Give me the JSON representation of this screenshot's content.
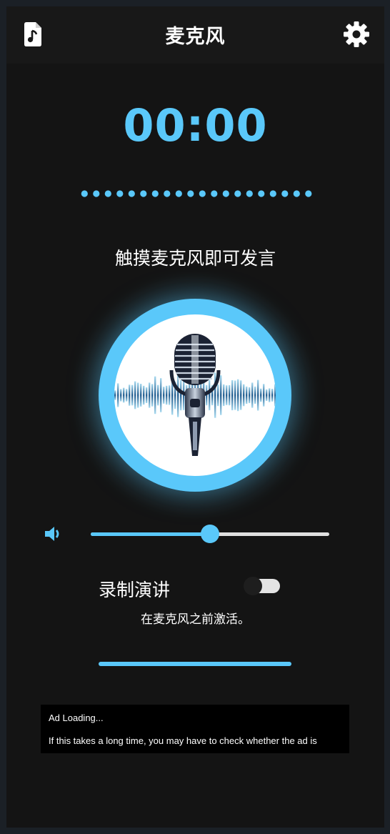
{
  "header": {
    "title": "麦克风",
    "left_icon": "music-file-icon",
    "right_icon": "gear-icon"
  },
  "timer": {
    "value": "00:00"
  },
  "level_meter": {
    "dot_count": 20
  },
  "prompt": {
    "text": "触摸麦克风即可发言"
  },
  "mic_button": {
    "icon": "microphone-icon"
  },
  "volume": {
    "icon": "speaker-icon",
    "level": 0.5
  },
  "record_speech": {
    "label": "录制演讲",
    "enabled": false
  },
  "hint": {
    "text": "在麦克风之前激活。"
  },
  "progress": {
    "value": 1.0
  },
  "ad": {
    "title": "Ad Loading...",
    "body": "If this takes a long time, you may have to check whether the ad is"
  },
  "colors": {
    "accent": "#5ac8fa",
    "background": "#141414",
    "header": "#181818",
    "text": "#ffffff"
  }
}
